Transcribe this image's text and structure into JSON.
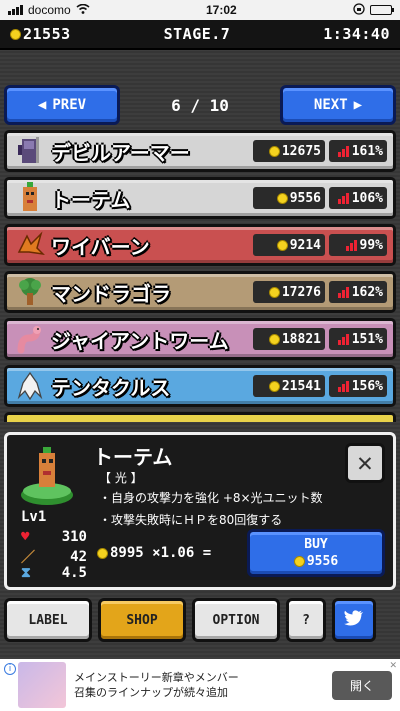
{
  "status_bar": {
    "carrier": "docomo",
    "time": "17:02"
  },
  "top_bar": {
    "coins": "21553",
    "stage": "STAGE.7",
    "timer": "1:34:40"
  },
  "pager": {
    "prev_label": "PREV",
    "next_label": "NEXT",
    "page": "6 / 10"
  },
  "units": [
    {
      "name": "デビルアーマー",
      "price": "12675",
      "ratio": "161%",
      "color": "#d4d4d4",
      "icon": "armor-icon"
    },
    {
      "name": "トーテム",
      "price": "9556",
      "ratio": "106%",
      "color": "#d6d6d6",
      "icon": "totem-icon"
    },
    {
      "name": "ワイバーン",
      "price": "9214",
      "ratio": "99%",
      "color": "#c95050",
      "icon": "wyvern-icon"
    },
    {
      "name": "マンドラゴラ",
      "price": "17276",
      "ratio": "162%",
      "color": "#b49b76",
      "icon": "mandragora-icon"
    },
    {
      "name": "ジャイアントワーム",
      "price": "18821",
      "ratio": "151%",
      "color": "#c890b8",
      "icon": "worm-icon"
    },
    {
      "name": "テンタクルス",
      "price": "21541",
      "ratio": "156%",
      "color": "#5aa8e0",
      "icon": "tentacle-icon"
    }
  ],
  "detail": {
    "name": "トーテム",
    "element": "【 光 】",
    "desc1": "・自身の攻撃力を強化 +8×光ユニット数",
    "desc2": "・攻撃失敗時にＨＰを80回復する",
    "level": "Lv1",
    "hp": "310",
    "attack": "42",
    "speed": "4.5",
    "formula": "8995 ×1.06 =",
    "buy_label": "BUY",
    "buy_price": "9556",
    "close_label": "✕"
  },
  "menu": {
    "label": "LABEL",
    "shop": "SHOP",
    "option": "OPTION",
    "help": "?"
  },
  "ad": {
    "text1": "メインストーリー新章やメンバー",
    "text2": "召集のラインナップが続々追加",
    "open": "開く"
  }
}
